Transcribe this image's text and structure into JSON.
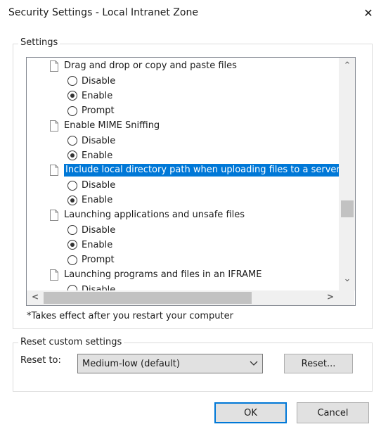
{
  "window": {
    "title": "Security Settings - Local Intranet Zone",
    "close_glyph": "✕"
  },
  "settings_group": {
    "label": "Settings"
  },
  "entries": [
    {
      "label": "Drag and drop or copy and paste files",
      "selected": false,
      "options": [
        {
          "label": "Disable",
          "checked": false
        },
        {
          "label": "Enable",
          "checked": true
        },
        {
          "label": "Prompt",
          "checked": false
        }
      ]
    },
    {
      "label": "Enable MIME Sniffing",
      "selected": false,
      "options": [
        {
          "label": "Disable",
          "checked": false
        },
        {
          "label": "Enable",
          "checked": true
        }
      ]
    },
    {
      "label": "Include local directory path when uploading files to a server",
      "selected": true,
      "options": [
        {
          "label": "Disable",
          "checked": false
        },
        {
          "label": "Enable",
          "checked": true
        }
      ]
    },
    {
      "label": "Launching applications and unsafe files",
      "selected": false,
      "options": [
        {
          "label": "Disable",
          "checked": false
        },
        {
          "label": "Enable",
          "checked": true
        },
        {
          "label": "Prompt",
          "checked": false
        }
      ]
    },
    {
      "label": "Launching programs and files in an IFRAME",
      "selected": false,
      "options": [
        {
          "label": "Disable",
          "checked": false
        }
      ]
    }
  ],
  "scroll": {
    "up_glyph": "⌃",
    "down_glyph": "⌄",
    "left_glyph": "<",
    "right_glyph": ">"
  },
  "note": "*Takes effect after you restart your computer",
  "reset_group": {
    "label": "Reset custom settings",
    "reset_to_label": "Reset to:",
    "dropdown_value": "Medium-low (default)",
    "reset_button": "Reset..."
  },
  "buttons": {
    "ok": "OK",
    "cancel": "Cancel"
  }
}
